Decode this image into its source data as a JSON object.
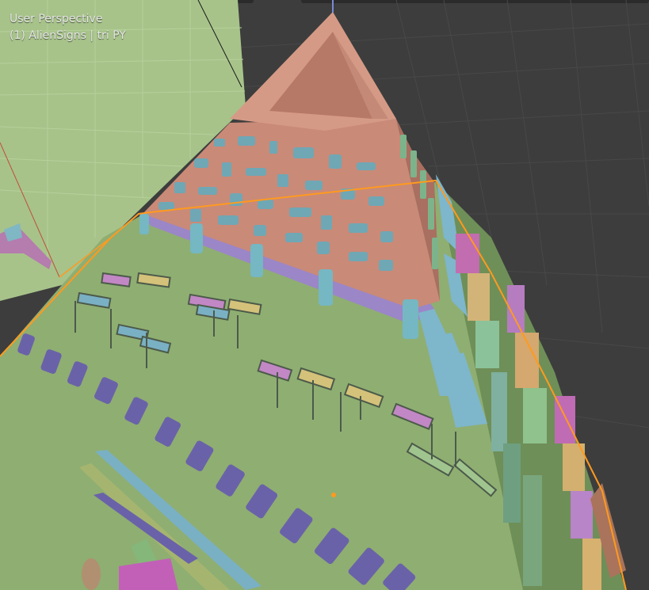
{
  "viewport": {
    "view_name": "User Perspective",
    "object_info": "(1) AlienSigns | tri PY"
  },
  "colors": {
    "background": "#3d3d3d",
    "grid": "#4a4a4a",
    "ground": "#8fae72",
    "ground_dark": "#7e9c63",
    "wall_left": "#a7c38a",
    "pyramid": "#c98a78",
    "pyramid_dark": "#a96f60",
    "pyramid_light": "#d9a08e",
    "base_band": "#9b86c8",
    "glyph_teal": "#6fb0bd",
    "glyph_purple": "#6a62a8",
    "selection": "#ff9a1f",
    "axis_red": "#c0503a"
  }
}
